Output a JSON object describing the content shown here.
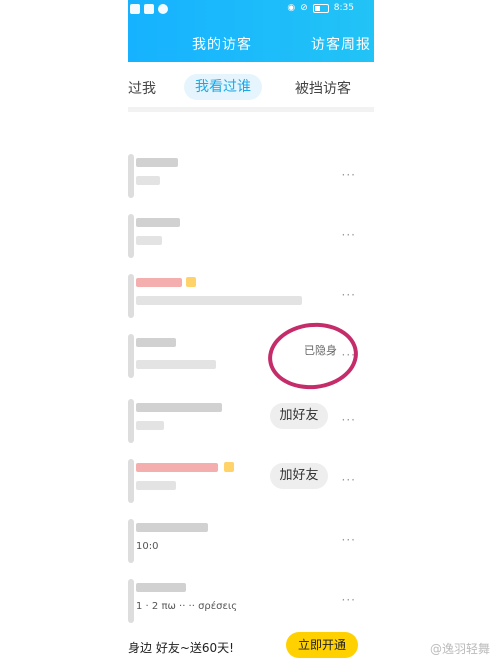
{
  "status_bar": {
    "time": "8:35"
  },
  "header": {
    "title": "我的访客",
    "report": "访客周报"
  },
  "tabs": [
    {
      "label": "过我"
    },
    {
      "label": "我看过谁"
    },
    {
      "label": "被挡访客"
    }
  ],
  "rows": [
    {
      "more": "···"
    },
    {
      "more": "···"
    },
    {
      "more": "···"
    },
    {
      "status": "已隐身",
      "more": "···"
    },
    {
      "button": "加好友",
      "more": "···"
    },
    {
      "button": "加好友",
      "more": "···"
    },
    {
      "partial": "10:0",
      "more": "···"
    },
    {
      "partial": "1 · 2 πω   ·· ·· σρέσεις",
      "more": "···"
    }
  ],
  "promo": {
    "text": "身边      好友~送60天!",
    "button": "立即开通"
  },
  "watermark": "@逸羽轻舞",
  "colors": {
    "header": "#16b2ff",
    "accent": "#1aa9e8",
    "cta": "#ffd100",
    "circle": "#c42c6a"
  }
}
